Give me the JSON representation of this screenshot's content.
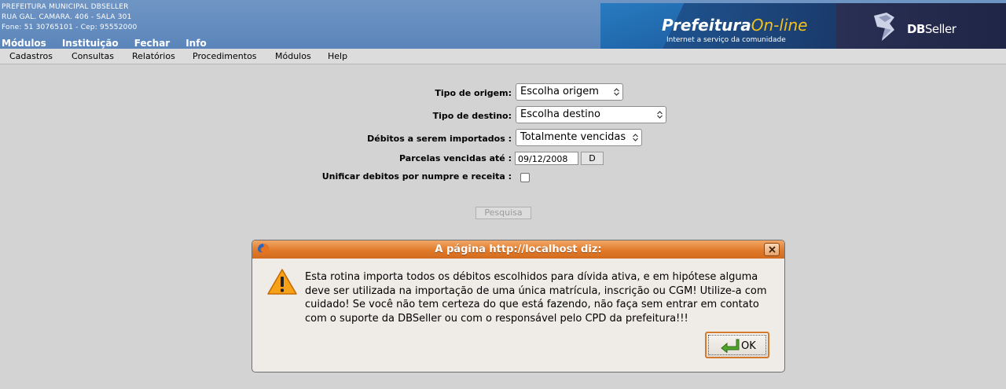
{
  "header": {
    "address_lines": [
      "PREFEITURA MUNICIPAL DBSELLER",
      "RUA GAL. CAMARA. 406 - SALA 301",
      "Fone: 51 30765101  - Cep: 95552000"
    ],
    "top_menu": [
      "Módulos",
      "Instituição",
      "Fechar",
      "Info"
    ],
    "logo": {
      "prefix": "Prefeitura",
      "suffix": "On-line",
      "tagline": "Internet a serviço da comunidade"
    },
    "brand": {
      "bold": "DB",
      "rest": "Seller"
    }
  },
  "menubar": [
    "Cadastros",
    "Consultas",
    "Relatórios",
    "Procedimentos",
    "Módulos",
    "Help"
  ],
  "form": {
    "origem_label": "Tipo de origem:",
    "origem_value": "Escolha origem",
    "destino_label": "Tipo de destino:",
    "destino_value": "Escolha destino",
    "debitos_label": "Débitos a serem importados :",
    "debitos_value": "Totalmente vencidas",
    "parcelas_label": "Parcelas vencidas até :",
    "parcelas_value": "09/12/2008",
    "date_button": "D",
    "unificar_label": "Unificar debitos por numpre e receita :",
    "unificar_checked": false,
    "pesquisa_button": "Pesquisa"
  },
  "dialog": {
    "title": "A página http://localhost diz:",
    "message": "Esta rotina importa todos os débitos escolhidos para dívida ativa, e em hipótese alguma deve ser utilizada na importação de uma única matrícula, inscrição ou CGM! Utilize-a com cuidado! Se você não tem certeza do que está fazendo, não faça sem entrar em contato com o suporte da DBSeller ou com o responsável pelo CPD da prefeitura!!!",
    "ok_label": "OK"
  }
}
